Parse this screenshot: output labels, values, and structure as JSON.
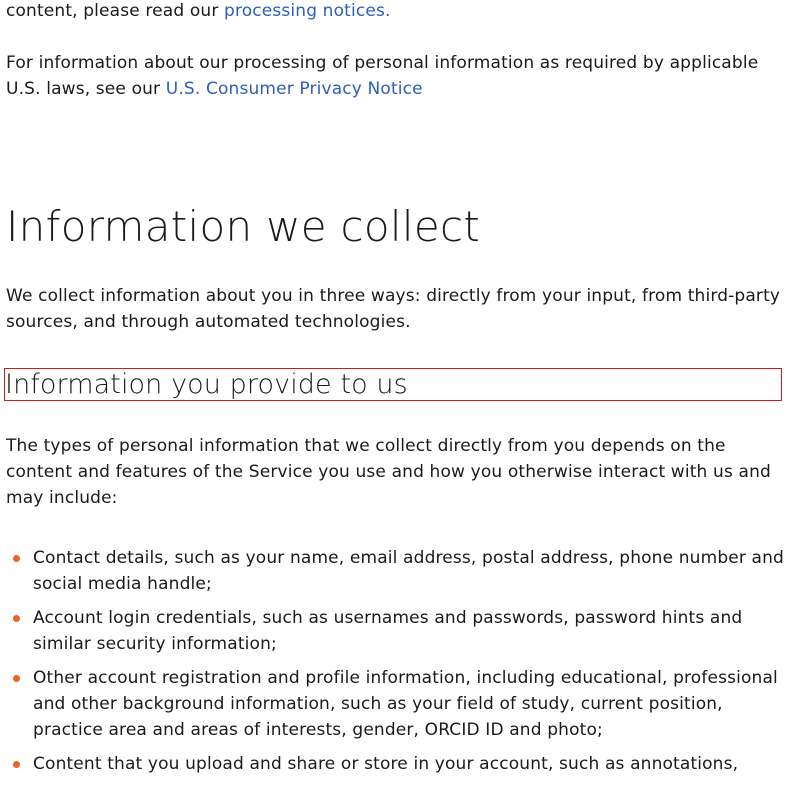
{
  "intro_top": {
    "prefix": "content, please read our ",
    "link": "processing notices."
  },
  "us_notice": {
    "prefix": "For information about our processing of personal information as required by applicable U.S. laws, see our ",
    "link": "U.S. Consumer Privacy Notice"
  },
  "section": {
    "heading": "Information we collect",
    "intro": "We collect information about you in three ways: directly from your input, from third-party sources, and through automated technologies."
  },
  "subsection": {
    "heading": "Information you provide to us",
    "body": "The types of personal information that we collect directly from you depends on the content and features of the Service you use and how you otherwise interact with us and may include:",
    "items": [
      "Contact details, such as your name, email address, postal address, phone number and social media handle;",
      "Account login credentials, such as usernames and passwords, password hints and similar security information;",
      "Other account registration and profile information, including educational, professional and other background information, such as your field of study, current position, practice area and areas of interests, gender, ORCID ID and photo;",
      "Content that you upload and share or store in your account, such as annotations,"
    ]
  },
  "colors": {
    "link": "#2e5fb8",
    "bullet": "#e8642a",
    "highlight_border": "#d11a1a"
  }
}
